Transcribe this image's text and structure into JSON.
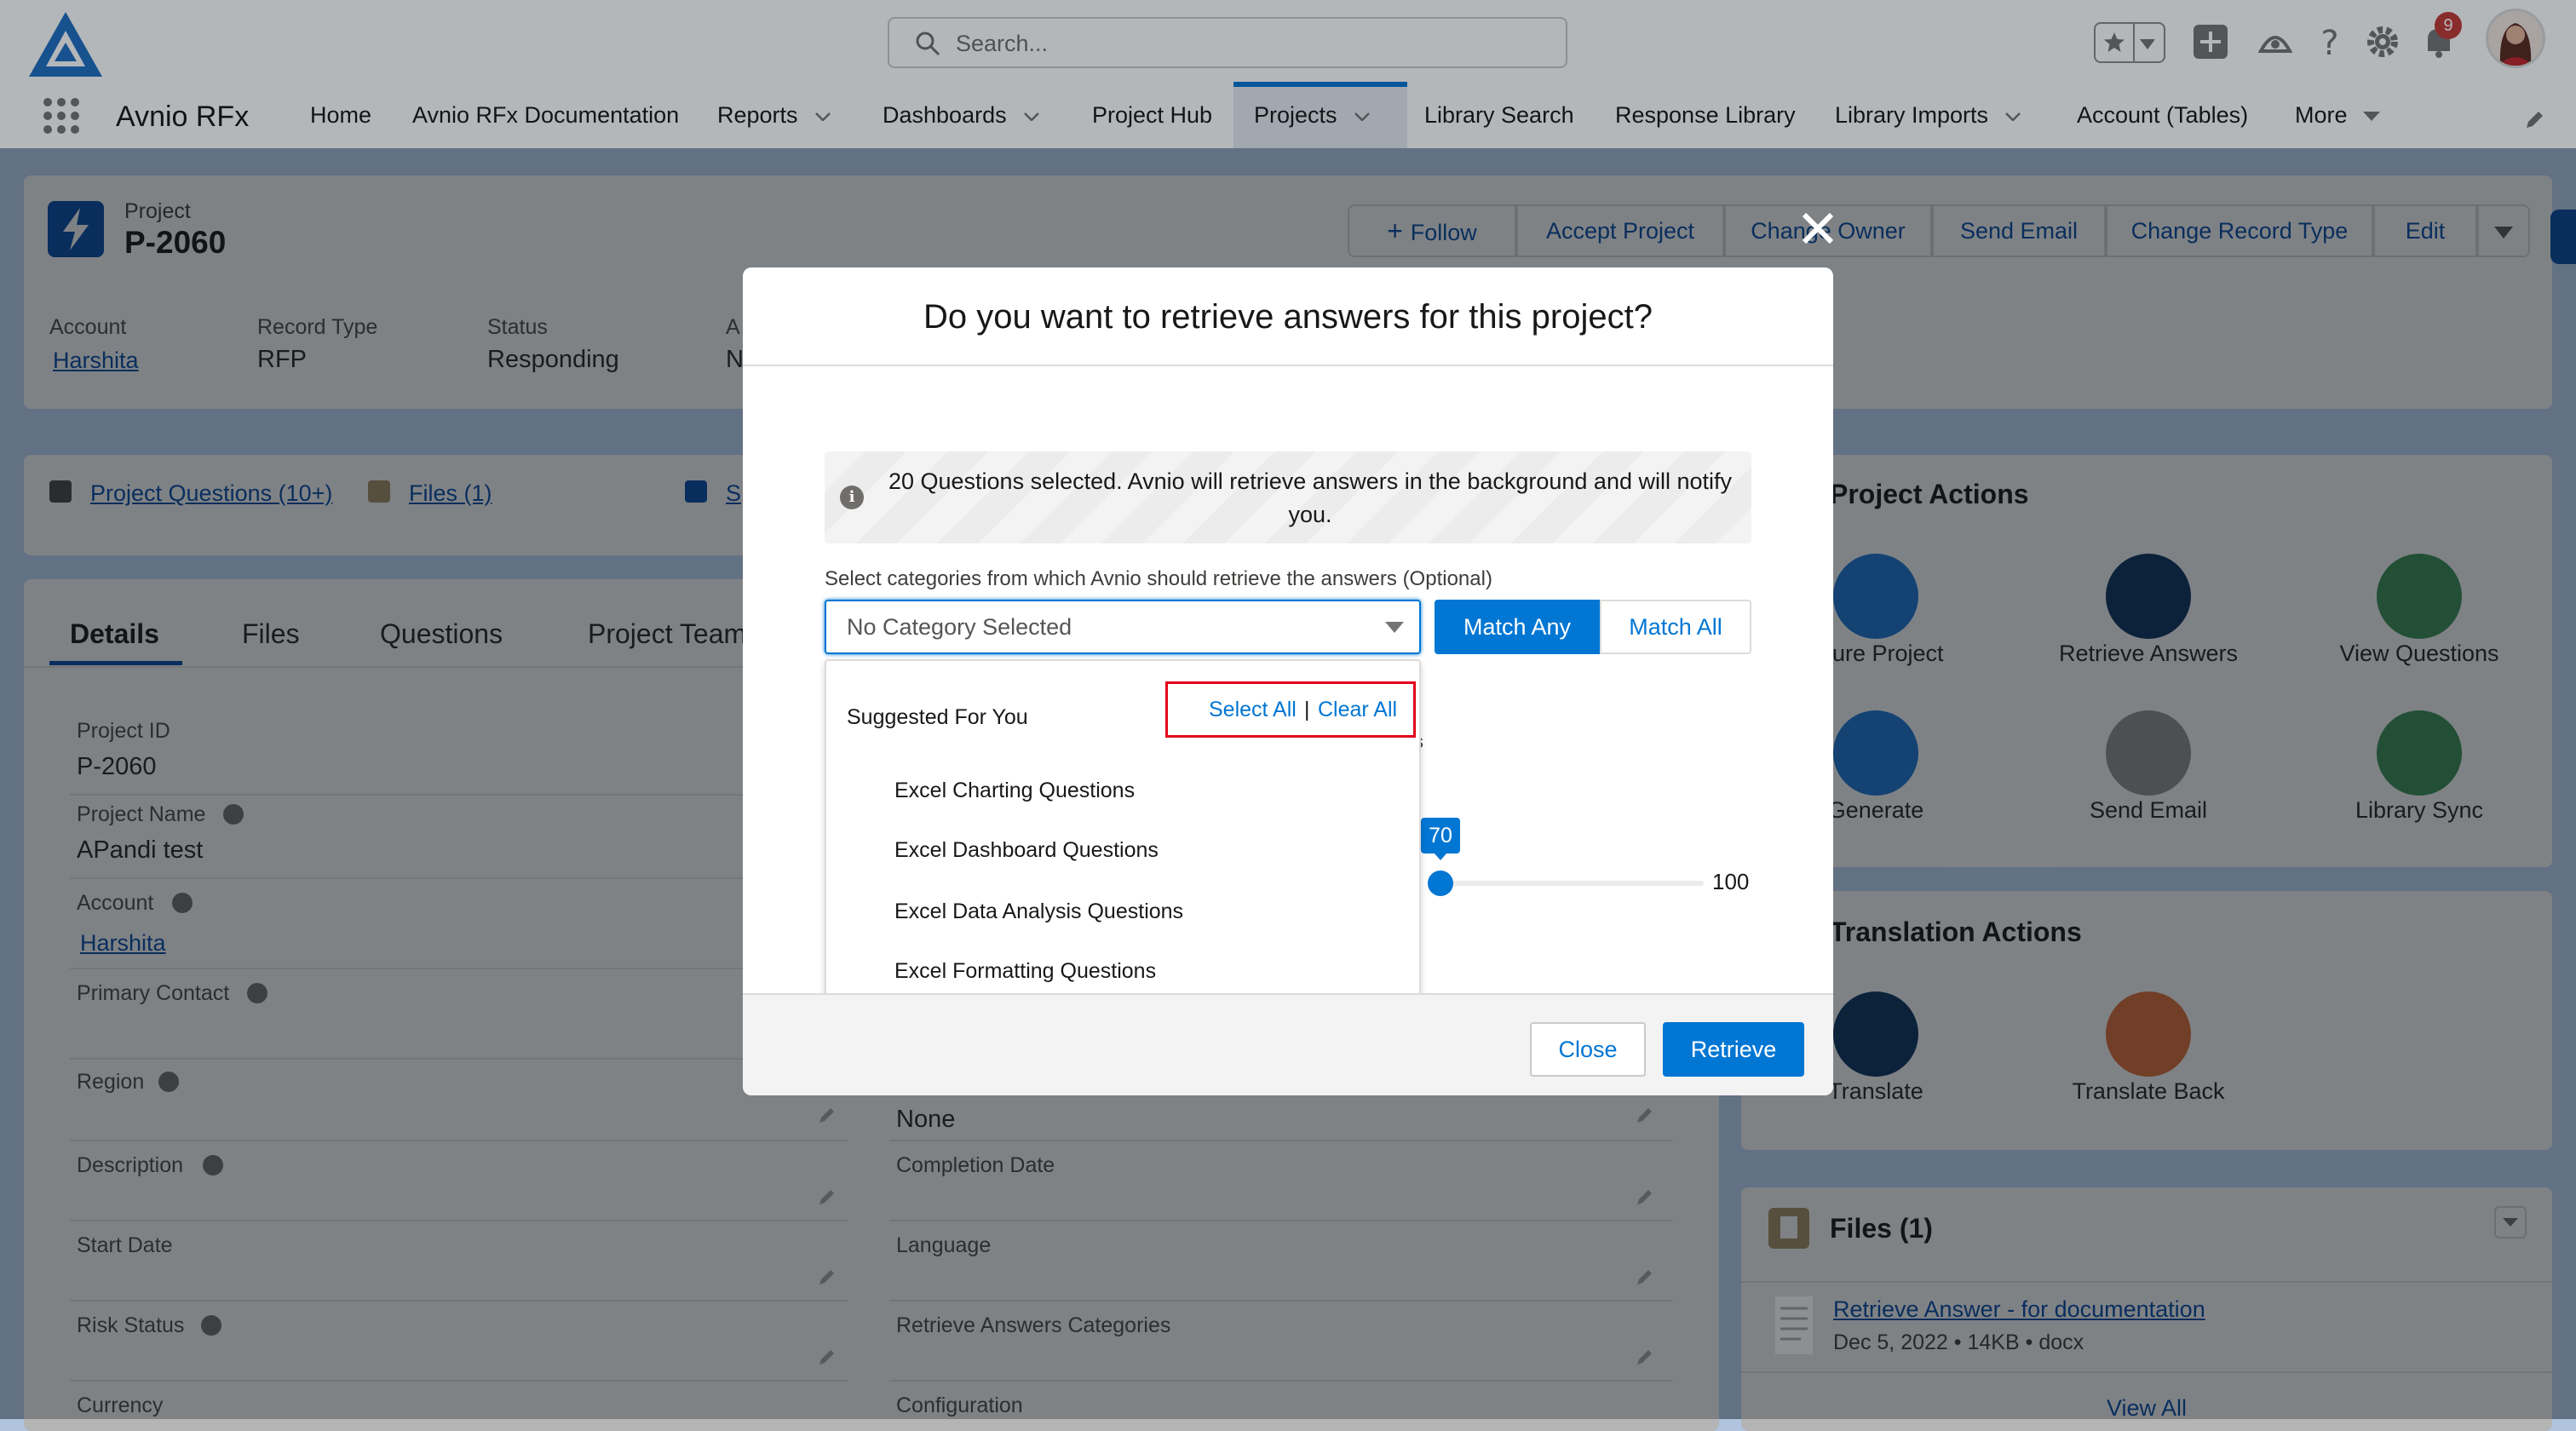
{
  "header": {
    "search_placeholder": "Search...",
    "notification_count": "9",
    "app_name": "Avnio RFx",
    "nav": [
      {
        "label": "Home",
        "has_menu": false
      },
      {
        "label": "Avnio RFx Documentation",
        "has_menu": false
      },
      {
        "label": "Reports",
        "has_menu": true
      },
      {
        "label": "Dashboards",
        "has_menu": true
      },
      {
        "label": "Project Hub",
        "has_menu": false
      },
      {
        "label": "Projects",
        "has_menu": true,
        "active": true
      },
      {
        "label": "Library Search",
        "has_menu": false
      },
      {
        "label": "Response Library",
        "has_menu": false
      },
      {
        "label": "Library Imports",
        "has_menu": true
      },
      {
        "label": "Account (Tables)",
        "has_menu": false
      },
      {
        "label": "More",
        "has_menu": true
      }
    ]
  },
  "record": {
    "object_label": "Project",
    "name": "P-2060",
    "actions": [
      "Follow",
      "Accept Project",
      "Change Owner",
      "Send Email",
      "Change Record Type",
      "Edit"
    ],
    "highlights": [
      {
        "label": "Account",
        "value": "Harshita",
        "link": true
      },
      {
        "label": "Record Type",
        "value": "RFP"
      },
      {
        "label": "Status",
        "value": "Responding"
      },
      {
        "label": "A",
        "value": "N"
      }
    ],
    "related_links": [
      {
        "label": "Project Questions (10+)"
      },
      {
        "label": "Files (1)"
      },
      {
        "label": "S"
      }
    ],
    "tabs": [
      "Details",
      "Files",
      "Questions",
      "Project Team"
    ],
    "fields_left": [
      {
        "label": "Project ID",
        "value": "P-2060"
      },
      {
        "label": "Project Name",
        "value": "APandi test"
      },
      {
        "label": "Account",
        "value": "Harshita"
      },
      {
        "label": "Primary Contact",
        "value": ""
      },
      {
        "label": "Region",
        "value": ""
      },
      {
        "label": "Description",
        "value": ""
      },
      {
        "label": "Start Date",
        "value": ""
      },
      {
        "label": "Risk Status",
        "value": ""
      },
      {
        "label": "Currency",
        "value": ""
      }
    ],
    "fields_right": [
      {
        "label": "",
        "value": "None"
      },
      {
        "label": "Completion Date",
        "value": ""
      },
      {
        "label": "Language",
        "value": ""
      },
      {
        "label": "Retrieve Answers Categories",
        "value": ""
      },
      {
        "label": "Configuration",
        "value": ""
      }
    ]
  },
  "sidebar": {
    "project_actions_title": "Project Actions",
    "project_actions": [
      {
        "label": "figure Project",
        "icon": "configure-icon",
        "color": "#1b96ff"
      },
      {
        "label": "Retrieve Answers",
        "icon": "retrieve-icon",
        "color": "#032d60"
      },
      {
        "label": "View Questions",
        "icon": "list-icon",
        "color": "#2e844a"
      },
      {
        "label": "Generate",
        "icon": "generate-icon",
        "color": "#1b96ff"
      },
      {
        "label": "Send Email",
        "icon": "email-icon",
        "color": "#747474"
      },
      {
        "label": "Library Sync",
        "icon": "sync-icon",
        "color": "#2e844a"
      }
    ],
    "translation_title": "Translation Actions",
    "translation_actions": [
      {
        "label": "Translate",
        "icon": "translate-icon",
        "color": "#032d60"
      },
      {
        "label": "Translate Back",
        "icon": "translate-back-icon",
        "color": "#d2691e"
      }
    ],
    "files_title": "Files (1)",
    "file": {
      "name": "Retrieve Answer - for documentation",
      "date": "Dec 5, 2022",
      "size": "14KB",
      "ext": "docx"
    },
    "view_all": "View All"
  },
  "modal": {
    "title": "Do you want to retrieve answers for this project?",
    "info_text": "20 Questions selected. Avnio will retrieve answers in the background and will notify you.",
    "category_label": "Select categories from which Avnio should retrieve the answers (Optional)",
    "combobox_value": "No Category Selected",
    "match_any": "Match Any",
    "match_all": "Match All",
    "dropdown_heading": "Suggested For You",
    "select_all": "Select All",
    "separator": "|",
    "clear_all": "Clear All",
    "categories": [
      "Excel Charting Questions",
      "Excel Dashboard Questions",
      "Excel Data Analysis Questions",
      "Excel Formatting Questions"
    ],
    "slider_value": 70,
    "slider_max": "100",
    "stray_text": "s",
    "close_label": "Close",
    "retrieve_label": "Retrieve"
  }
}
